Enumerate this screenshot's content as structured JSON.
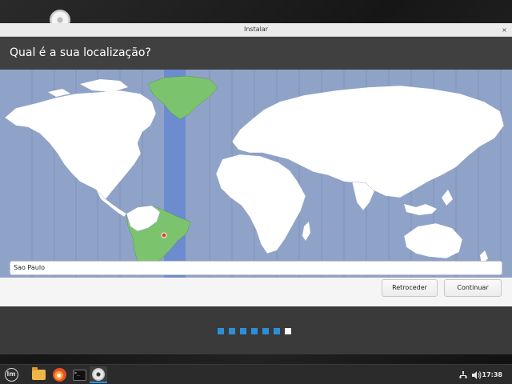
{
  "window": {
    "title": "Instalar",
    "close_glyph": "×"
  },
  "header": {
    "title": "Qual é a sua localização?"
  },
  "map": {
    "selected_timezone_city": "Sao Paulo",
    "ocean_color": "#8fa3c8",
    "land_color": "#ffffff",
    "highlight_zone_color": "#6c8ccf",
    "selected_region_color": "#7cc36e",
    "pin_color": "#e53935"
  },
  "location_field": {
    "value": "Sao Paulo"
  },
  "buttons": {
    "back_label": "Retroceder",
    "continue_label": "Continuar"
  },
  "progress": {
    "total_steps": 7,
    "current_step": 7,
    "step_color": "#2d8fd8",
    "current_color": "#ffffff"
  },
  "taskbar": {
    "apps": [
      "menu-icon",
      "files-icon",
      "firefox-icon",
      "terminal-icon",
      "installer-disc-icon"
    ],
    "terminal_glyph": ">_",
    "menu_glyph": "lm",
    "time": "17:38"
  }
}
